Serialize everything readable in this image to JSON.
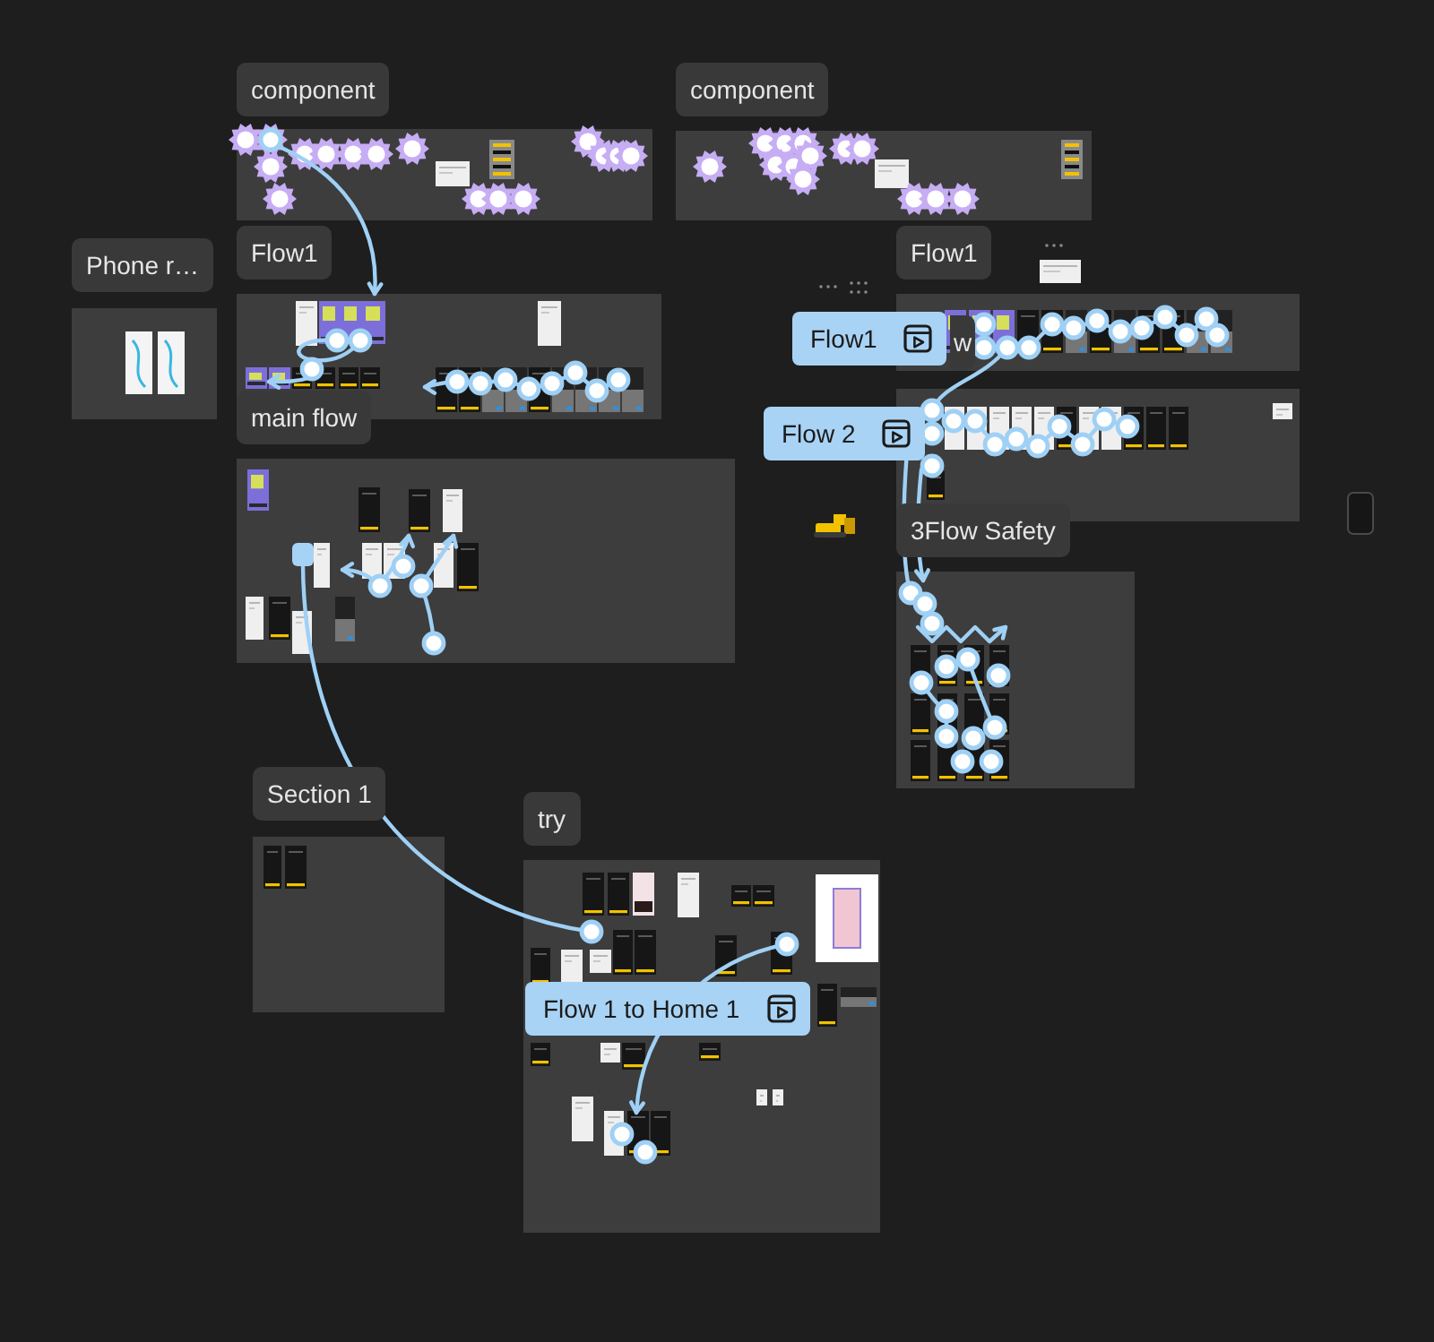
{
  "canvas": {
    "sections": [
      {
        "label": "component"
      },
      {
        "label": "component"
      },
      {
        "label": "Phone r…"
      },
      {
        "label": "Flow1"
      },
      {
        "label": "main flow"
      },
      {
        "label": "Flow1"
      },
      {
        "label": "w"
      },
      {
        "label": "3Flow Safety"
      },
      {
        "label": "Section 1"
      },
      {
        "label": "try"
      }
    ],
    "flow_starts": [
      {
        "label": "Flow1"
      },
      {
        "label": "Flow 2"
      },
      {
        "label": "Flow 1 to Home 1"
      }
    ]
  }
}
